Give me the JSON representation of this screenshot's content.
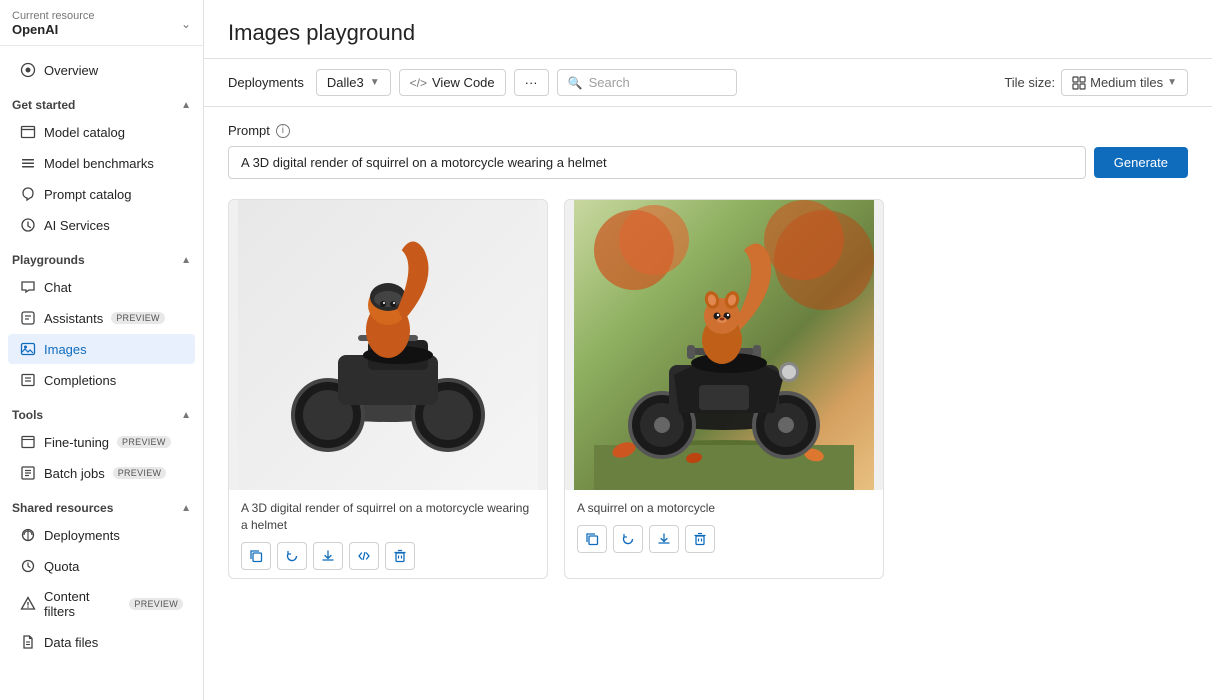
{
  "sidebar": {
    "resource_label": "Current resource",
    "resource_name": "OpenAI",
    "overview": "Overview",
    "get_started": "Get started",
    "model_catalog": "Model catalog",
    "model_benchmarks": "Model benchmarks",
    "prompt_catalog": "Prompt catalog",
    "ai_services": "AI Services",
    "playgrounds": "Playgrounds",
    "chat": "Chat",
    "assistants": "Assistants",
    "assistants_badge": "PREVIEW",
    "images": "Images",
    "completions": "Completions",
    "tools": "Tools",
    "fine_tuning": "Fine-tuning",
    "fine_tuning_badge": "PREVIEW",
    "batch_jobs": "Batch jobs",
    "batch_jobs_badge": "PREVIEW",
    "shared_resources": "Shared resources",
    "deployments": "Deployments",
    "quota": "Quota",
    "content_filters": "Content filters",
    "content_filters_badge": "PREVIEW",
    "data_files": "Data files"
  },
  "toolbar": {
    "deployments_label": "Deployments",
    "deployment_value": "Dalle3",
    "view_code": "View Code",
    "more_btn": "···",
    "search_placeholder": "Search",
    "tile_size_label": "Tile size:",
    "tile_size_value": "Medium tiles"
  },
  "prompt": {
    "label": "Prompt",
    "value": "A 3D digital render of squirrel on a motorcycle wearing a helmet",
    "generate_label": "Generate"
  },
  "images": [
    {
      "id": 1,
      "caption": "A 3D digital render of squirrel on a motorcycle wearing a helmet",
      "alt": "3D render squirrel motorcycle helmet"
    },
    {
      "id": 2,
      "caption": "A squirrel on a motorcycle",
      "alt": "Squirrel on a motorcycle"
    }
  ],
  "image_actions": {
    "copy": "⧉",
    "refresh": "↺",
    "download": "⬇",
    "code": "{ }",
    "delete": "🗑"
  },
  "icons": {
    "overview": "⊙",
    "model_catalog": "⊞",
    "model_benchmarks": "≡",
    "prompt_catalog": "☁",
    "ai_services": "⟳",
    "chat": "💬",
    "assistants": "⊟",
    "images": "🖼",
    "completions": "⊡",
    "fine_tuning": "⊞",
    "batch_jobs": "⊟",
    "deployments": "⊙",
    "quota": "⊛",
    "content_filters": "⊕",
    "data_files": "⊟"
  }
}
